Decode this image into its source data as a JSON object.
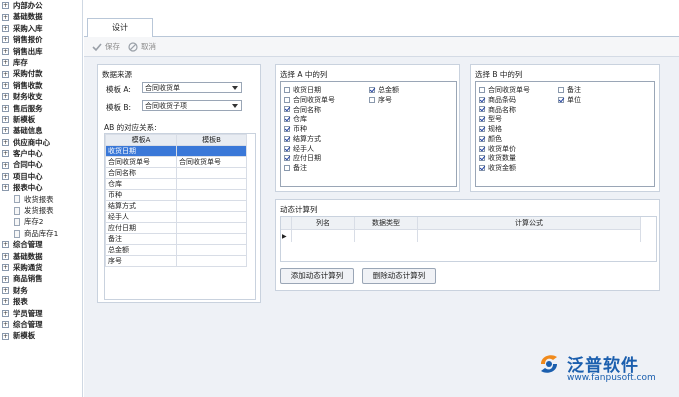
{
  "sidebar": {
    "top_items": [
      "内部办公",
      "基础数据",
      "采购入库",
      "销售报价",
      "销售出库",
      "库存",
      "采购付款",
      "销售收款",
      "财务收支",
      "售后服务",
      "新模板",
      "基础信息",
      "供应商中心",
      "客户中心",
      "合同中心",
      "项目中心",
      "报表中心"
    ],
    "sub_items": [
      "收货报表",
      "发货报表",
      "库存2",
      "商品库存1"
    ],
    "bottom_items": [
      "综合管理",
      "基础数据",
      "采购通货",
      "商品销售",
      "财务",
      "报表",
      "学员管理",
      "综合管理",
      "新模板"
    ]
  },
  "tab": {
    "label": "设计"
  },
  "toolbar": {
    "save_label": "保存",
    "cancel_label": "取消"
  },
  "datasource": {
    "heading": "数据来源",
    "template_a_label": "模板 A:",
    "template_a_value": "合同收货单",
    "template_b_label": "模板 B:",
    "template_b_value": "合同收货子项",
    "mapping_label": "AB 的对应关系:",
    "columns": [
      "模板A",
      "模板B"
    ],
    "rows": [
      [
        "收货日期",
        ""
      ],
      [
        "合同收货单号",
        "合同收货单号"
      ],
      [
        "合同名称",
        ""
      ],
      [
        "仓库",
        ""
      ],
      [
        "币种",
        ""
      ],
      [
        "结算方式",
        ""
      ],
      [
        "经手人",
        ""
      ],
      [
        "应付日期",
        ""
      ],
      [
        "备注",
        ""
      ],
      [
        "总金额",
        ""
      ],
      [
        "序号",
        ""
      ]
    ]
  },
  "columns_a": {
    "heading": "选择 A 中的列",
    "col1": [
      {
        "label": "收货日期",
        "checked": false
      },
      {
        "label": "合同收货单号",
        "checked": false
      },
      {
        "label": "合同名称",
        "checked": true
      },
      {
        "label": "仓库",
        "checked": true
      },
      {
        "label": "币种",
        "checked": true
      },
      {
        "label": "结算方式",
        "checked": true
      },
      {
        "label": "经手人",
        "checked": true
      },
      {
        "label": "应付日期",
        "checked": true
      },
      {
        "label": "备注",
        "checked": false
      }
    ],
    "col2": [
      {
        "label": "总金额",
        "checked": true
      },
      {
        "label": "序号",
        "checked": false
      }
    ]
  },
  "columns_b": {
    "heading": "选择 B 中的列",
    "col1": [
      {
        "label": "合同收货单号",
        "checked": false
      },
      {
        "label": "商品条码",
        "checked": true
      },
      {
        "label": "商品名称",
        "checked": true
      },
      {
        "label": "型号",
        "checked": true
      },
      {
        "label": "规格",
        "checked": true
      },
      {
        "label": "颜色",
        "checked": true
      },
      {
        "label": "收货单价",
        "checked": true
      },
      {
        "label": "收货数量",
        "checked": true
      },
      {
        "label": "收货金额",
        "checked": true
      }
    ],
    "col2": [
      {
        "label": "备注",
        "checked": false
      },
      {
        "label": "单位",
        "checked": true
      }
    ]
  },
  "dynamic": {
    "heading": "动态计算列",
    "columns": [
      "列名",
      "数据类型",
      "计算公式"
    ],
    "add_button": "添加动态计算列",
    "delete_button": "删除动态计算列"
  },
  "logo": {
    "name": "泛普软件",
    "url": "www.fanpusoft.com"
  },
  "colors": {
    "selection": "#3a78d8",
    "logo_orange": "#f08a1c",
    "logo_blue": "#1b5fae"
  }
}
